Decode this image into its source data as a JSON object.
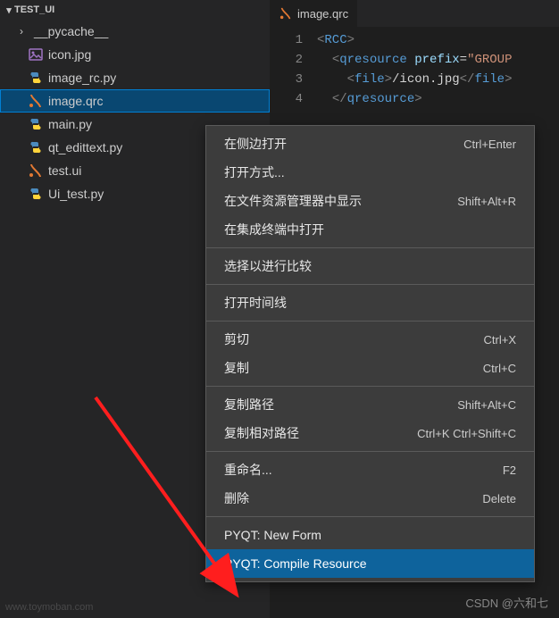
{
  "sidebar": {
    "title": "TEST_UI",
    "items": [
      {
        "label": "__pycache__",
        "type": "folder",
        "icon": "chevron-right-icon"
      },
      {
        "label": "icon.jpg",
        "type": "file",
        "icon": "image-icon"
      },
      {
        "label": "image_rc.py",
        "type": "file",
        "icon": "python-icon"
      },
      {
        "label": "image.qrc",
        "type": "file",
        "icon": "xml-icon",
        "selected": true
      },
      {
        "label": "main.py",
        "type": "file",
        "icon": "python-icon"
      },
      {
        "label": "qt_edittext.py",
        "type": "file",
        "icon": "python-icon"
      },
      {
        "label": "test.ui",
        "type": "file",
        "icon": "xml-icon"
      },
      {
        "label": "Ui_test.py",
        "type": "file",
        "icon": "python-icon"
      }
    ]
  },
  "editor": {
    "tab": {
      "label": "image.qrc",
      "icon": "xml-icon"
    },
    "lines": [
      {
        "num": "1",
        "html": "<span class='t-brk'>&lt;</span><span class='t-tag'>RCC</span><span class='t-brk'>&gt;</span>"
      },
      {
        "num": "2",
        "html": "  <span class='t-brk'>&lt;</span><span class='t-tag'>qresource</span> <span class='t-attr'>prefix</span><span class='t-txt'>=</span><span class='t-str'>\"GROUP</span>"
      },
      {
        "num": "3",
        "html": "    <span class='t-brk'>&lt;</span><span class='t-tag'>file</span><span class='t-brk'>&gt;</span><span class='t-txt'>/icon.jpg</span><span class='t-brk'>&lt;/</span><span class='t-tag'>file</span><span class='t-brk'>&gt;</span>"
      },
      {
        "num": "4",
        "html": "  <span class='t-brk'>&lt;/</span><span class='t-tag'>qresource</span><span class='t-brk'>&gt;</span>"
      }
    ]
  },
  "context_menu": {
    "groups": [
      [
        {
          "label": "在侧边打开",
          "shortcut": "Ctrl+Enter"
        },
        {
          "label": "打开方式...",
          "shortcut": ""
        },
        {
          "label": "在文件资源管理器中显示",
          "shortcut": "Shift+Alt+R"
        },
        {
          "label": "在集成终端中打开",
          "shortcut": ""
        }
      ],
      [
        {
          "label": "选择以进行比较",
          "shortcut": ""
        }
      ],
      [
        {
          "label": "打开时间线",
          "shortcut": ""
        }
      ],
      [
        {
          "label": "剪切",
          "shortcut": "Ctrl+X"
        },
        {
          "label": "复制",
          "shortcut": "Ctrl+C"
        }
      ],
      [
        {
          "label": "复制路径",
          "shortcut": "Shift+Alt+C"
        },
        {
          "label": "复制相对路径",
          "shortcut": "Ctrl+K Ctrl+Shift+C"
        }
      ],
      [
        {
          "label": "重命名...",
          "shortcut": "F2"
        },
        {
          "label": "删除",
          "shortcut": "Delete"
        }
      ],
      [
        {
          "label": "PYQT: New Form",
          "shortcut": ""
        },
        {
          "label": "PYQT: Compile Resource",
          "shortcut": "",
          "highlighted": true
        }
      ]
    ]
  },
  "watermarks": {
    "w1": "www.toymoban.com",
    "w2": "CSDN @六和七"
  }
}
